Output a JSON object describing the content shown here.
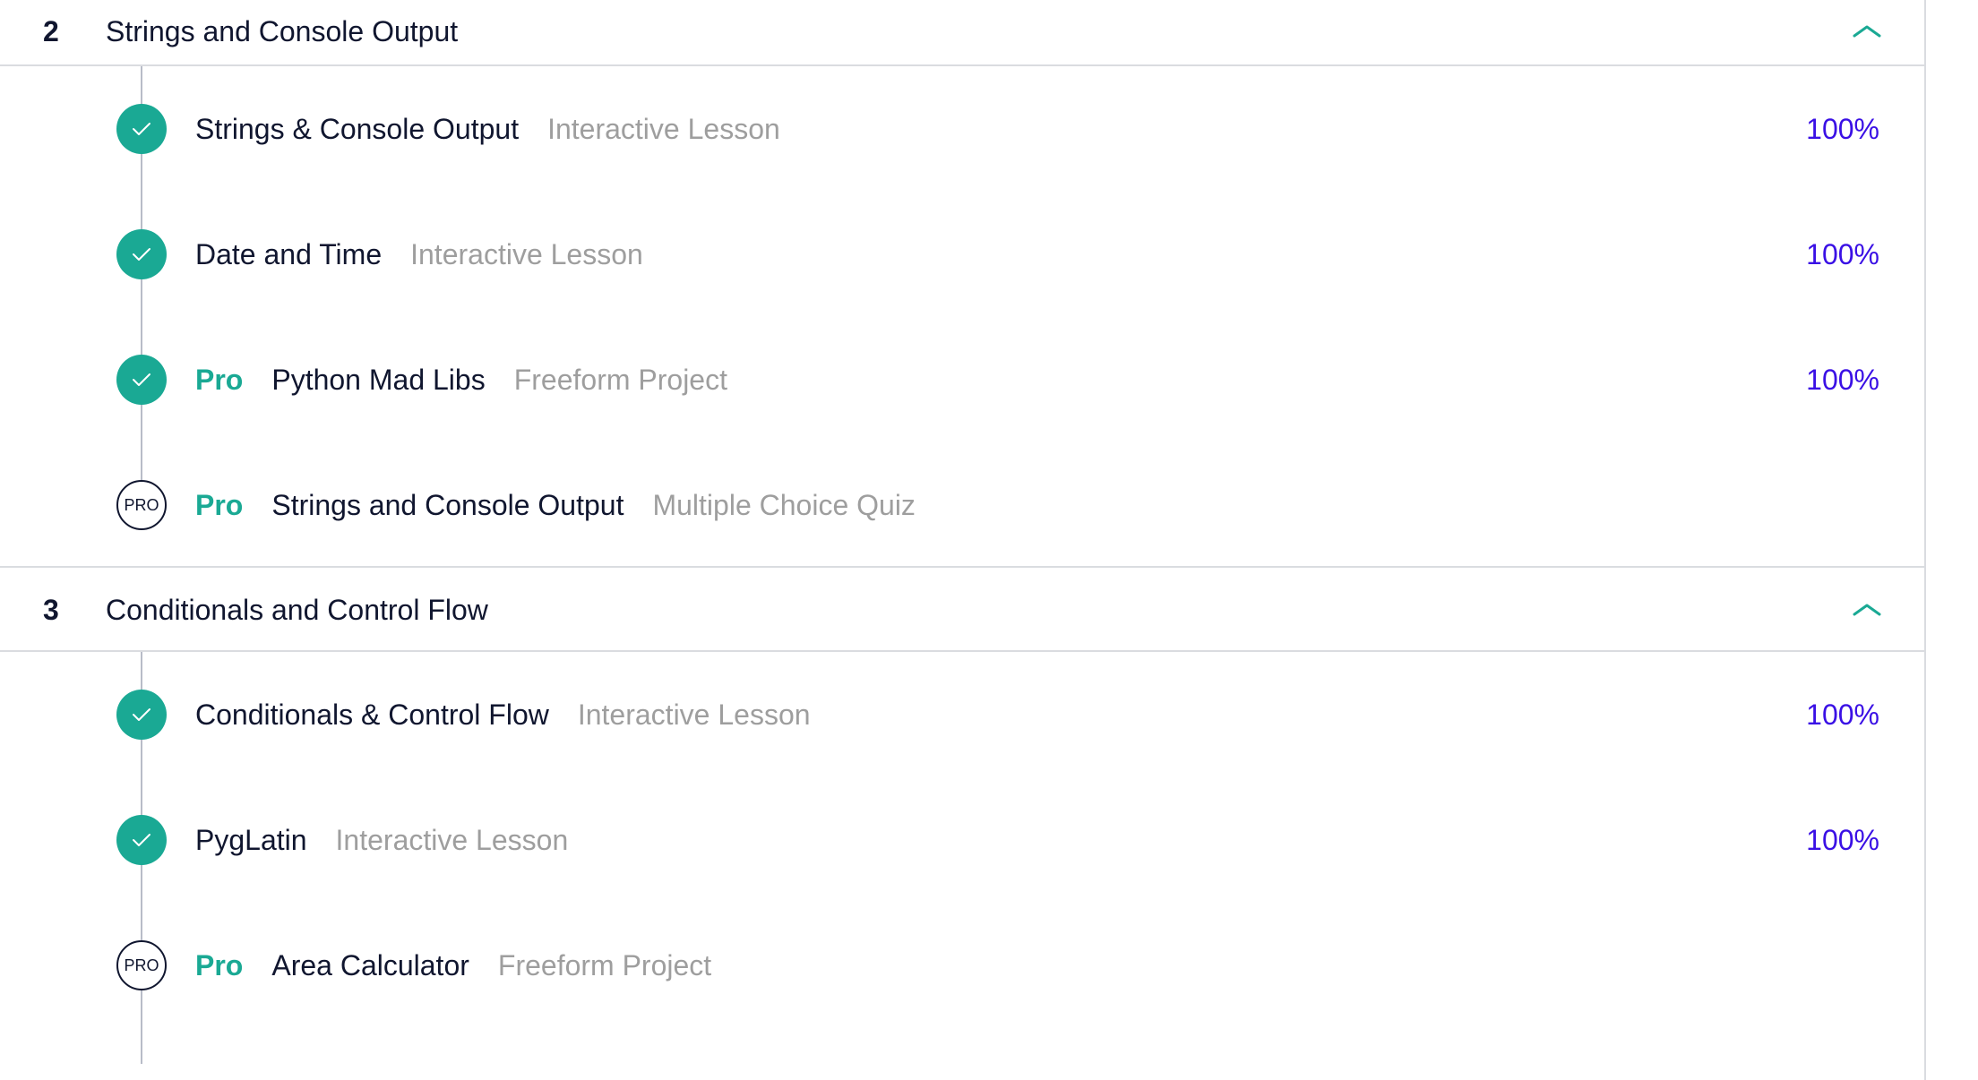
{
  "modules": [
    {
      "number": "2",
      "title": "Strings and Console Output",
      "expanded": true,
      "items": [
        {
          "status": "completed",
          "pro": false,
          "title": "Strings & Console Output",
          "type": "Interactive Lesson",
          "progress": "100%"
        },
        {
          "status": "completed",
          "pro": false,
          "title": "Date and Time",
          "type": "Interactive Lesson",
          "progress": "100%"
        },
        {
          "status": "completed",
          "pro": true,
          "title": "Python Mad Libs",
          "type": "Freeform Project",
          "progress": "100%"
        },
        {
          "status": "locked",
          "pro": true,
          "title": "Strings and Console Output",
          "type": "Multiple Choice Quiz",
          "progress": ""
        }
      ]
    },
    {
      "number": "3",
      "title": "Conditionals and Control Flow",
      "expanded": true,
      "items": [
        {
          "status": "completed",
          "pro": false,
          "title": "Conditionals & Control Flow",
          "type": "Interactive Lesson",
          "progress": "100%"
        },
        {
          "status": "completed",
          "pro": false,
          "title": "PygLatin",
          "type": "Interactive Lesson",
          "progress": "100%"
        },
        {
          "status": "locked",
          "pro": true,
          "title": "Area Calculator",
          "type": "Freeform Project",
          "progress": ""
        }
      ]
    }
  ],
  "labels": {
    "pro_tag": "Pro",
    "pro_badge": "PRO"
  },
  "icons": {
    "completed": "checkmark-icon",
    "locked": "pro-badge-icon",
    "collapse": "chevron-up-icon"
  },
  "colors": {
    "accent_teal": "#1aa994",
    "progress_blue": "#3a10e5",
    "text_dark": "#10162f",
    "text_muted": "#9e9e9e",
    "divider": "#dadce0"
  }
}
